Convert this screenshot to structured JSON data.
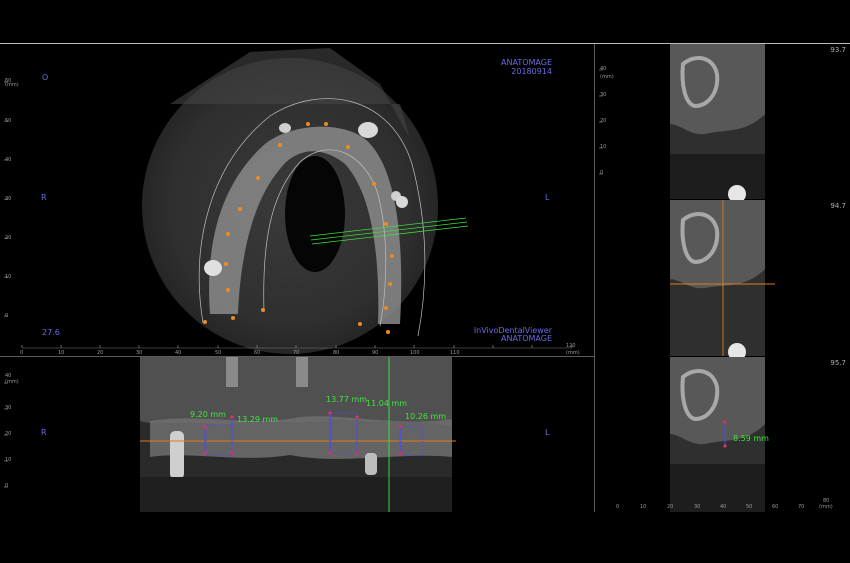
{
  "axial": {
    "brand_top": "ANATOMAGE",
    "date": "20180914",
    "viewer_line": "InVivoDentalViewer",
    "brand_bottom": "ANATOMAGE",
    "slice": "27.6",
    "left_marker": "R",
    "right_marker": "L",
    "corner_marker": "O",
    "unit": "(mm)",
    "x_ticks": [
      "0",
      "10",
      "20",
      "30",
      "40",
      "50",
      "60",
      "70",
      "80",
      "90",
      "100",
      "110",
      "120"
    ],
    "y_ticks": [
      "60",
      "50",
      "40",
      "30",
      "20",
      "10",
      "0"
    ]
  },
  "panoramic": {
    "left_marker": "R",
    "right_marker": "L",
    "unit": "(mm)",
    "y_ticks": [
      "40",
      "30",
      "20",
      "10",
      "0"
    ],
    "measurements": [
      "9.20 mm",
      "13.29 mm",
      "13.77 mm",
      "11.04 mm",
      "10.26 mm"
    ]
  },
  "cross_sections": {
    "slices": [
      "93.7",
      "94.7",
      "95.7"
    ],
    "unit": "(mm)",
    "y_ticks": [
      "40",
      "30",
      "20",
      "10",
      "0"
    ],
    "x_ticks": [
      "0",
      "10",
      "20",
      "30",
      "40",
      "50",
      "60",
      "70",
      "80"
    ],
    "measurement": "8.59 mm"
  },
  "colors": {
    "annotation": "#6a6ae6",
    "measurement": "#3ee63e",
    "crosshair": "#e07a1a",
    "points": "#f08c1e"
  }
}
